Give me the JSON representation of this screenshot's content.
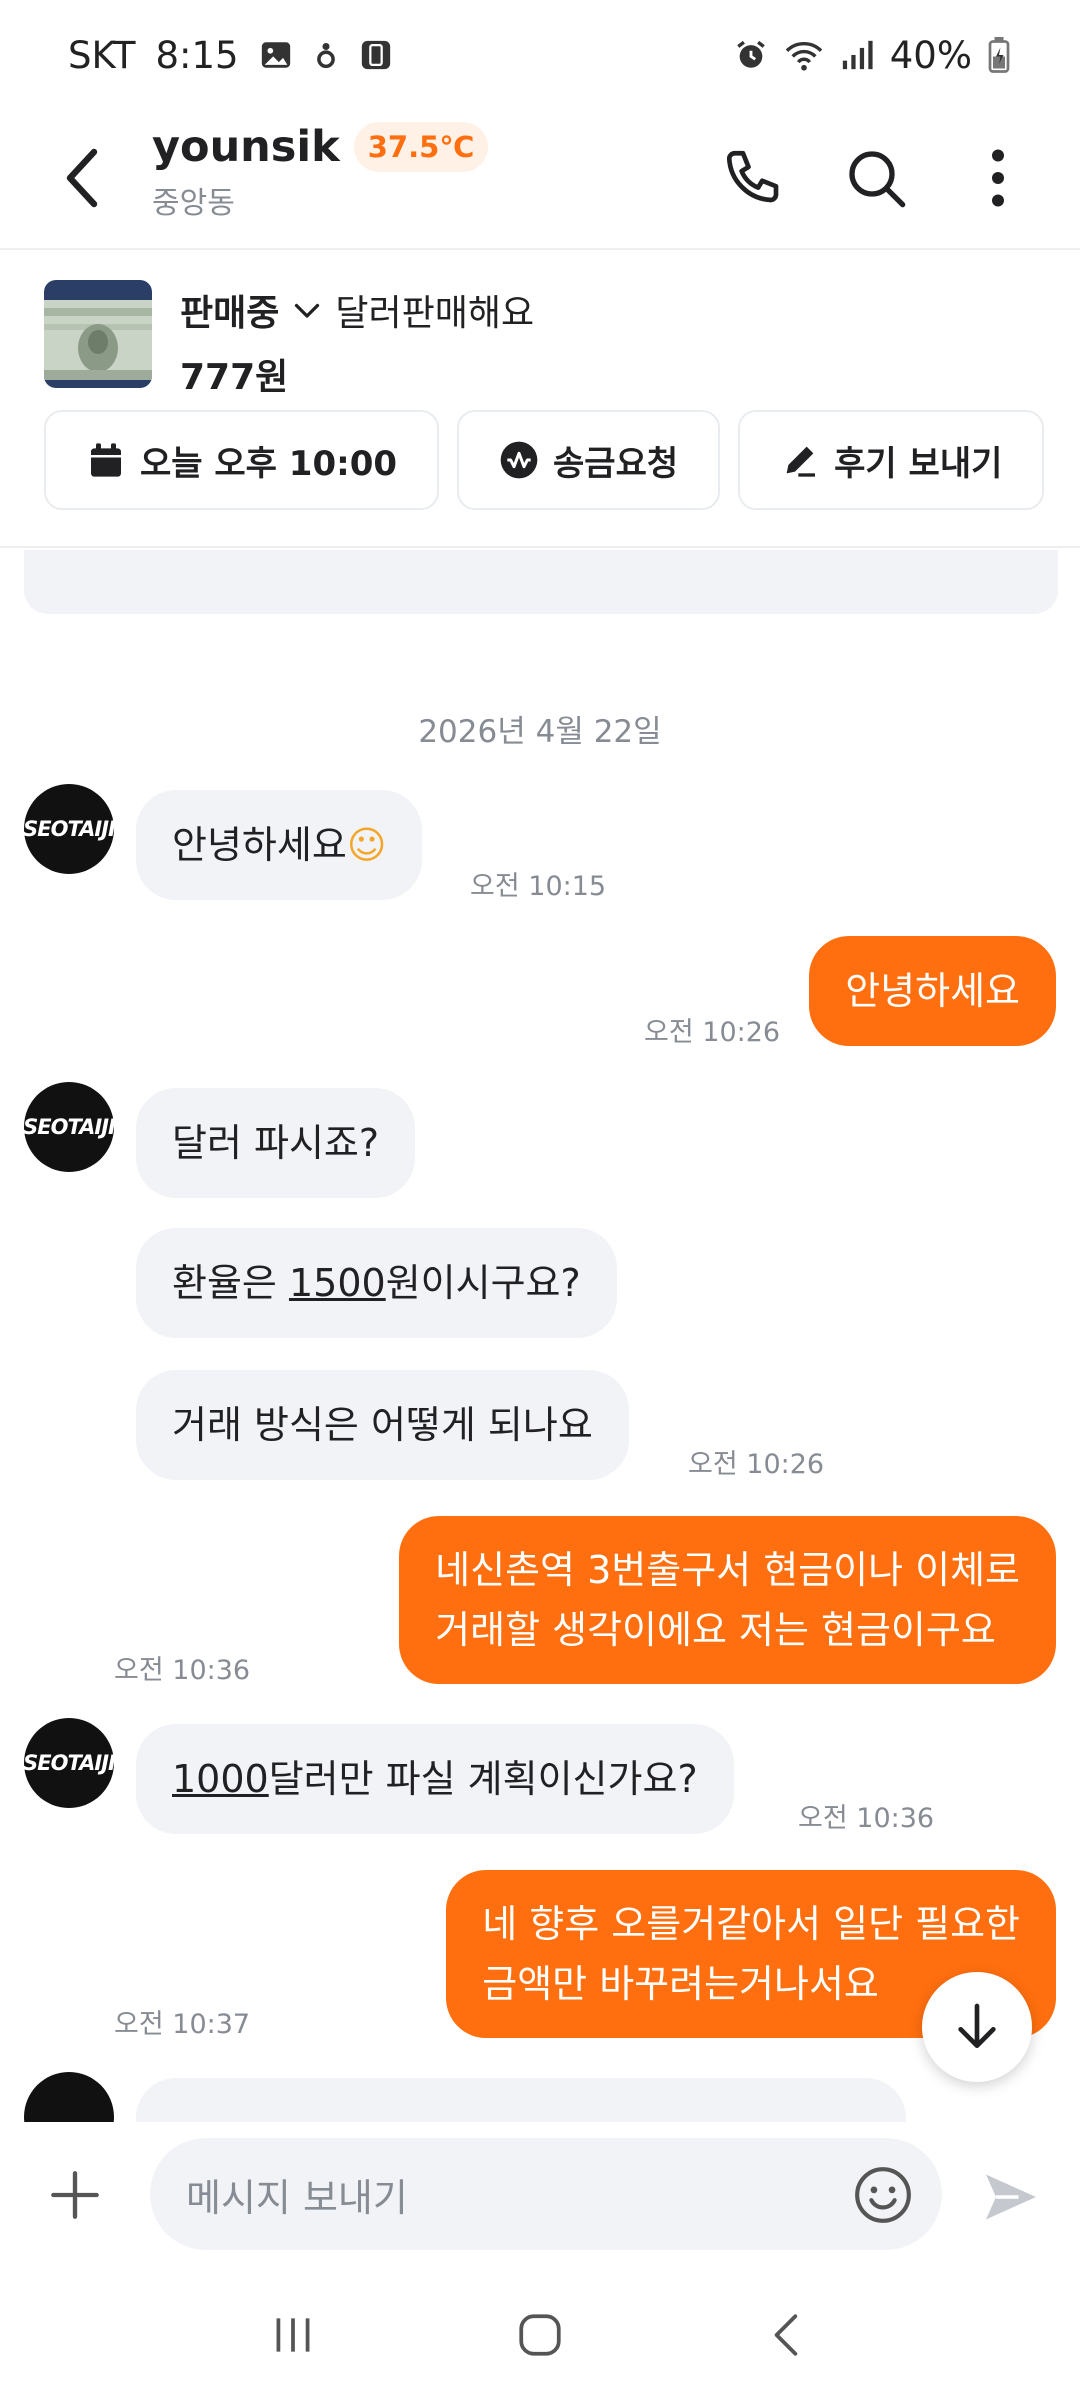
{
  "status_bar": {
    "carrier": "SKT",
    "time": "8:15",
    "battery": "40%"
  },
  "header": {
    "username": "younsik",
    "temperature": "37.5℃",
    "location": "중앙동"
  },
  "product": {
    "status": "판매중",
    "title": "달러판매해요",
    "price": "777원",
    "actions": [
      {
        "label": "오늘 오후 10:00",
        "icon": "calendar-icon"
      },
      {
        "label": "송금요청",
        "icon": "pay-icon"
      },
      {
        "label": "후기 보내기",
        "icon": "pencil-icon"
      }
    ]
  },
  "chat": {
    "date": "2026년 4월 22일",
    "avatar_text": "SEOTAIJI",
    "messages": [
      {
        "dir": "in",
        "pre": "안녕하세요",
        "ul": "",
        "post": "",
        "emoji": "☺",
        "time": "오전 10:15"
      },
      {
        "dir": "out",
        "line1": "안녕하세요",
        "line2": "",
        "time": "오전 10:26"
      },
      {
        "dir": "in",
        "pre": "달러 파시죠?",
        "ul": "",
        "post": "",
        "time": ""
      },
      {
        "dir": "in",
        "pre": "환율은 ",
        "ul": "1500",
        "post": "원이시구요?",
        "time": ""
      },
      {
        "dir": "in",
        "pre": "거래 방식은 어떻게 되나요",
        "ul": "",
        "post": "",
        "time": "오전 10:26"
      },
      {
        "dir": "out",
        "line1": "네신촌역 3번출구서 현금이나 이체로",
        "line2": "거래할 생각이에요 저는 현금이구요",
        "time": "오전 10:36"
      },
      {
        "dir": "in",
        "pre": "",
        "ul": "1000",
        "post": "달러만 파실 계획이신가요?",
        "time": "오전 10:36"
      },
      {
        "dir": "out",
        "line1": "네 향후 오를거같아서 일단 필요한",
        "line2": "금액만 바꾸려는거나서요",
        "time": "오전 10:37"
      }
    ]
  },
  "input": {
    "placeholder": "메시지 보내기"
  },
  "colors": {
    "accent": "#ff6f0f",
    "incoming_bubble": "#f2f3f6",
    "muted_text": "#868b94"
  }
}
